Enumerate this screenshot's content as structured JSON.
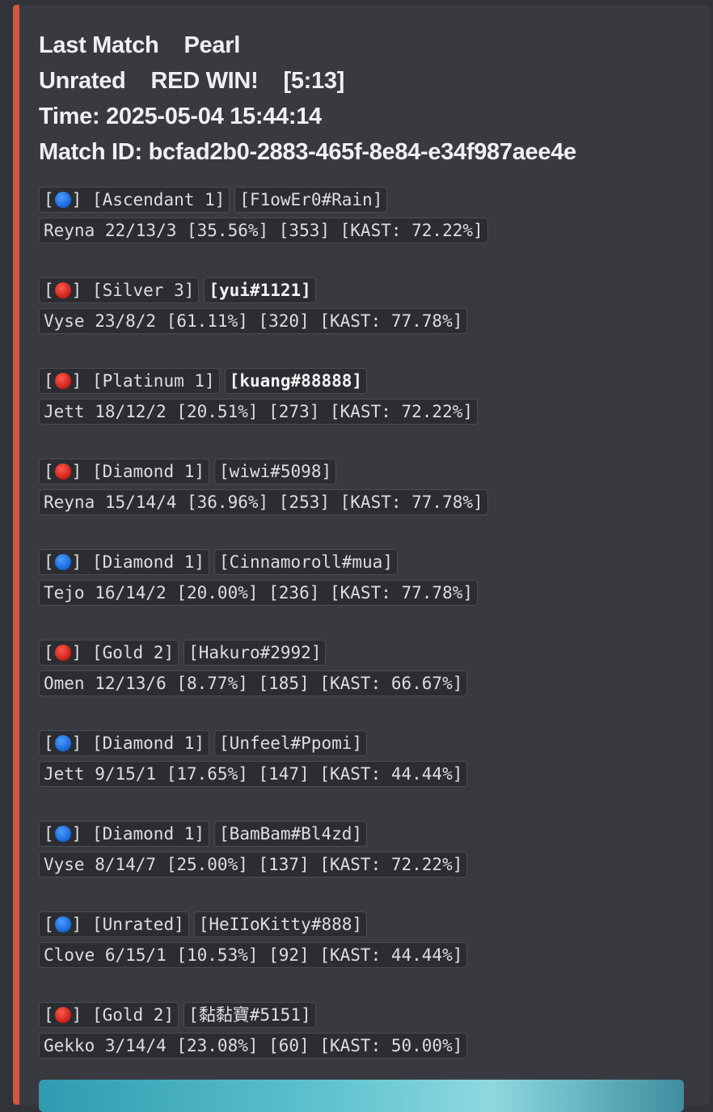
{
  "header": {
    "line1_label": "Last Match",
    "map": "Pearl",
    "mode": "Unrated",
    "result": "RED WIN!",
    "score": "[5:13]",
    "time_label": "Time:",
    "time_value": "2025-05-04 15:44:14",
    "match_id_label": "Match ID:",
    "match_id_value": "bcfad2b0-2883-465f-8e84-e34f987aee4e"
  },
  "colors": {
    "accent_bar": "#d9543f",
    "team_blue": "#1e78f0",
    "team_red": "#e03a30"
  },
  "players": [
    {
      "team": "blue",
      "rank": "[Ascendant 1]",
      "name": "[F1owEr0#Rain]",
      "bold": false,
      "stats": "Reyna 22/13/3 [35.56%] [353] [KAST: 72.22%]"
    },
    {
      "team": "red",
      "rank": "[Silver 3]",
      "name": "[yui#1121]",
      "bold": true,
      "stats": "Vyse 23/8/2 [61.11%] [320] [KAST: 77.78%]"
    },
    {
      "team": "red",
      "rank": "[Platinum 1]",
      "name": "[kuang#88888]",
      "bold": true,
      "stats": "Jett 18/12/2 [20.51%] [273] [KAST: 72.22%]"
    },
    {
      "team": "red",
      "rank": "[Diamond 1]",
      "name": "[wiwi#5098]",
      "bold": false,
      "stats": "Reyna 15/14/4 [36.96%] [253] [KAST: 77.78%]"
    },
    {
      "team": "blue",
      "rank": "[Diamond 1]",
      "name": "[Cinnamoroll#mua]",
      "bold": false,
      "stats": "Tejo 16/14/2 [20.00%] [236] [KAST: 77.78%]"
    },
    {
      "team": "red",
      "rank": "[Gold 2]",
      "name": "[Hakuro#2992]",
      "bold": false,
      "stats": "Omen 12/13/6 [8.77%] [185] [KAST: 66.67%]"
    },
    {
      "team": "blue",
      "rank": "[Diamond 1]",
      "name": "[Unfeel#Ppomi]",
      "bold": false,
      "stats": "Jett 9/15/1 [17.65%] [147] [KAST: 44.44%]"
    },
    {
      "team": "blue",
      "rank": "[Diamond 1]",
      "name": "[BamBam#Bl4zd]",
      "bold": false,
      "stats": "Vyse 8/14/7 [25.00%] [137] [KAST: 72.22%]"
    },
    {
      "team": "blue",
      "rank": "[Unrated]",
      "name": "[HeIIoKitty#888]",
      "bold": false,
      "stats": "Clove 6/15/1 [10.53%] [92] [KAST: 44.44%]"
    },
    {
      "team": "red",
      "rank": "[Gold 2]",
      "name": "[黏黏寶#5151]",
      "bold": false,
      "stats": "Gekko 3/14/4 [23.08%] [60] [KAST: 50.00%]"
    }
  ]
}
